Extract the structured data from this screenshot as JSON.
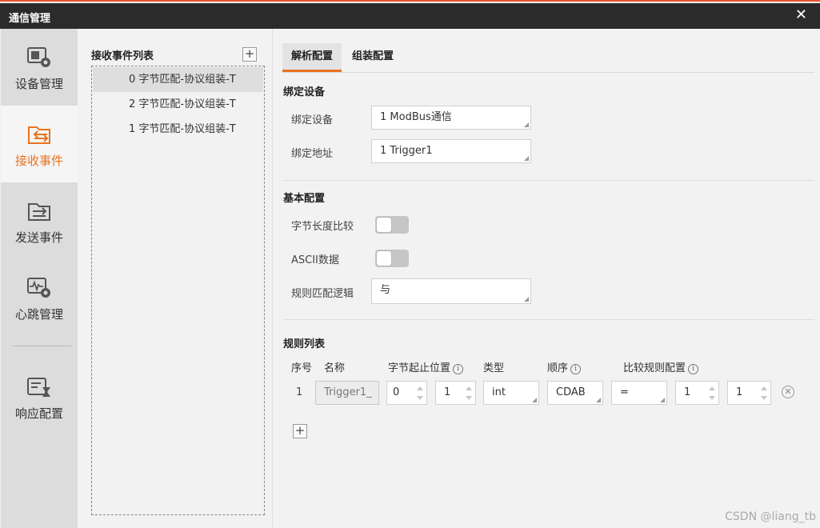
{
  "window": {
    "title": "通信管理",
    "close_glyph": "✕"
  },
  "nav": {
    "items": [
      {
        "label": "设备管理",
        "icon": "device-gear-icon"
      },
      {
        "label": "接收事件",
        "icon": "receive-event-icon",
        "active": true
      },
      {
        "label": "发送事件",
        "icon": "send-event-icon"
      },
      {
        "label": "心跳管理",
        "icon": "heartbeat-gear-icon"
      },
      {
        "label": "响应配置",
        "icon": "response-config-icon"
      }
    ],
    "accent_color": "#e8731f"
  },
  "events": {
    "header": "接收事件列表",
    "add_glyph": "+",
    "rows": [
      {
        "label": "0 字节匹配-协议组装-T",
        "selected": true
      },
      {
        "label": "2 字节匹配-协议组装-T"
      },
      {
        "label": "1 字节匹配-协议组装-T"
      }
    ]
  },
  "tabs": [
    {
      "label": "解析配置",
      "active": true
    },
    {
      "label": "组装配置"
    }
  ],
  "bind_section": {
    "title": "绑定设备",
    "device_label": "绑定设备",
    "device_value": "1 ModBus通信",
    "address_label": "绑定地址",
    "address_value": "1 Trigger1"
  },
  "basic_section": {
    "title": "基本配置",
    "byte_length_label": "字节长度比较",
    "byte_length_on": false,
    "ascii_label": "ASCII数据",
    "ascii_on": false,
    "logic_label": "规则匹配逻辑",
    "logic_value": "与"
  },
  "rules": {
    "title": "规则列表",
    "headers": {
      "index": "序号",
      "name": "名称",
      "position": "字节起止位置",
      "type": "类型",
      "order": "顺序",
      "compare": "比较规则配置"
    },
    "info_glyph": "i",
    "row": {
      "index": "1",
      "name": "Trigger1_",
      "start": "0",
      "end": "1",
      "type": "int",
      "order": "CDAB",
      "operator": "=",
      "compare_a": "1",
      "compare_b": "1"
    },
    "delete_glyph": "✕",
    "add_glyph": "+"
  },
  "watermark": "CSDN @liang_tb"
}
